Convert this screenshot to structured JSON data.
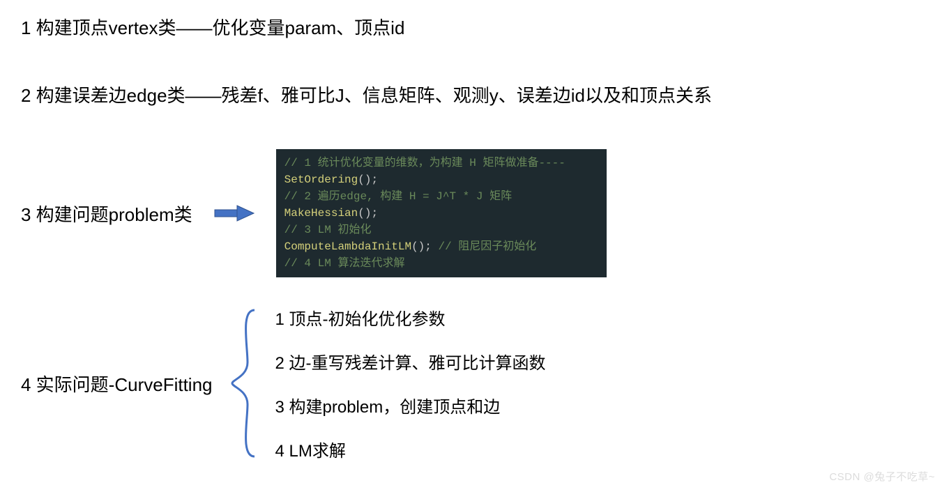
{
  "line1": "1 构建顶点vertex类——优化变量param、顶点id",
  "line2": "2 构建误差边edge类——残差f、雅可比J、信息矩阵、观测y、误差边id以及和顶点关系",
  "line3_label": "3 构建问题problem类",
  "code": {
    "c1": "// 1 统计优化变量的维数，为构建 H 矩阵做准备----",
    "f1": "SetOrdering",
    "p1": "();",
    "c2": "// 2 遍历edge, 构建 H = J^T * J 矩阵",
    "f2": "MakeHessian",
    "p2": "();",
    "c3": "// 3 LM 初始化",
    "f3": "ComputeLambdaInitLM",
    "p3": "();",
    "c3b": "  // 阻尼因子初始化",
    "c4": "// 4 LM 算法迭代求解"
  },
  "line4_label": "4 实际问题-CurveFitting",
  "sub": {
    "s1": "1 顶点-初始化优化参数",
    "s2": "2 边-重写残差计算、雅可比计算函数",
    "s3": "3 构建problem，创建顶点和边",
    "s4": "4 LM求解"
  },
  "watermark": "CSDN @兔子不吃草~"
}
